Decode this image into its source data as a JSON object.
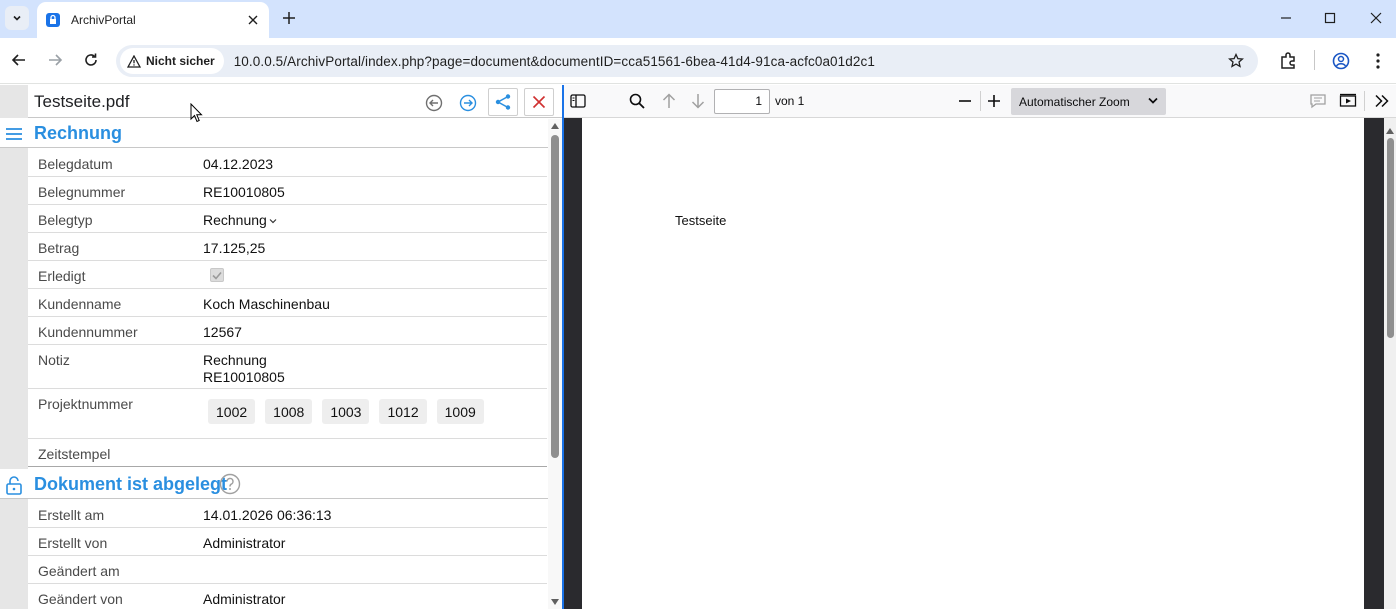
{
  "browser": {
    "tab_title": "ArchivPortal",
    "security_label": "Nicht sicher",
    "url": "10.0.0.5/ArchivPortal/index.php?page=document&documentID=cca51561-6bea-41d4-91ca-acfc0a01d2c1"
  },
  "document": {
    "title": "Testseite.pdf",
    "section_title": "Rechnung",
    "fields": [
      {
        "label": "Belegdatum",
        "value": "04.12.2023"
      },
      {
        "label": "Belegnummer",
        "value": "RE10010805"
      },
      {
        "label": "Belegtyp",
        "value": "Rechnung"
      },
      {
        "label": "Betrag",
        "value": "17.125,25"
      },
      {
        "label": "Erledigt",
        "value": ""
      },
      {
        "label": "Kundenname",
        "value": "Koch Maschinenbau"
      },
      {
        "label": "Kundennummer",
        "value": "12567"
      },
      {
        "label": "Notiz",
        "value_line1": "Rechnung",
        "value_line2": "RE10010805"
      },
      {
        "label": "Projektnummer",
        "tags": [
          "1002",
          "1008",
          "1003",
          "1012",
          "1009"
        ]
      },
      {
        "label": "Zeitstempel",
        "value": ""
      }
    ],
    "erledigt_checked": true
  },
  "archive": {
    "section_title": "Dokument ist abgelegt",
    "fields": [
      {
        "label": "Erstellt am",
        "value": "14.01.2026 06:36:13"
      },
      {
        "label": "Erstellt von",
        "value": "Administrator"
      },
      {
        "label": "Geändert am",
        "value": ""
      },
      {
        "label": "Geändert von",
        "value": "Administrator"
      }
    ]
  },
  "pdf": {
    "page_number": "1",
    "page_count": "von 1",
    "zoom": "Automatischer Zoom",
    "page_text": "Testseite"
  },
  "colors": {
    "accent": "#2a8fe0",
    "tabbar": "#d3e3fd",
    "close_red": "#d03030"
  }
}
